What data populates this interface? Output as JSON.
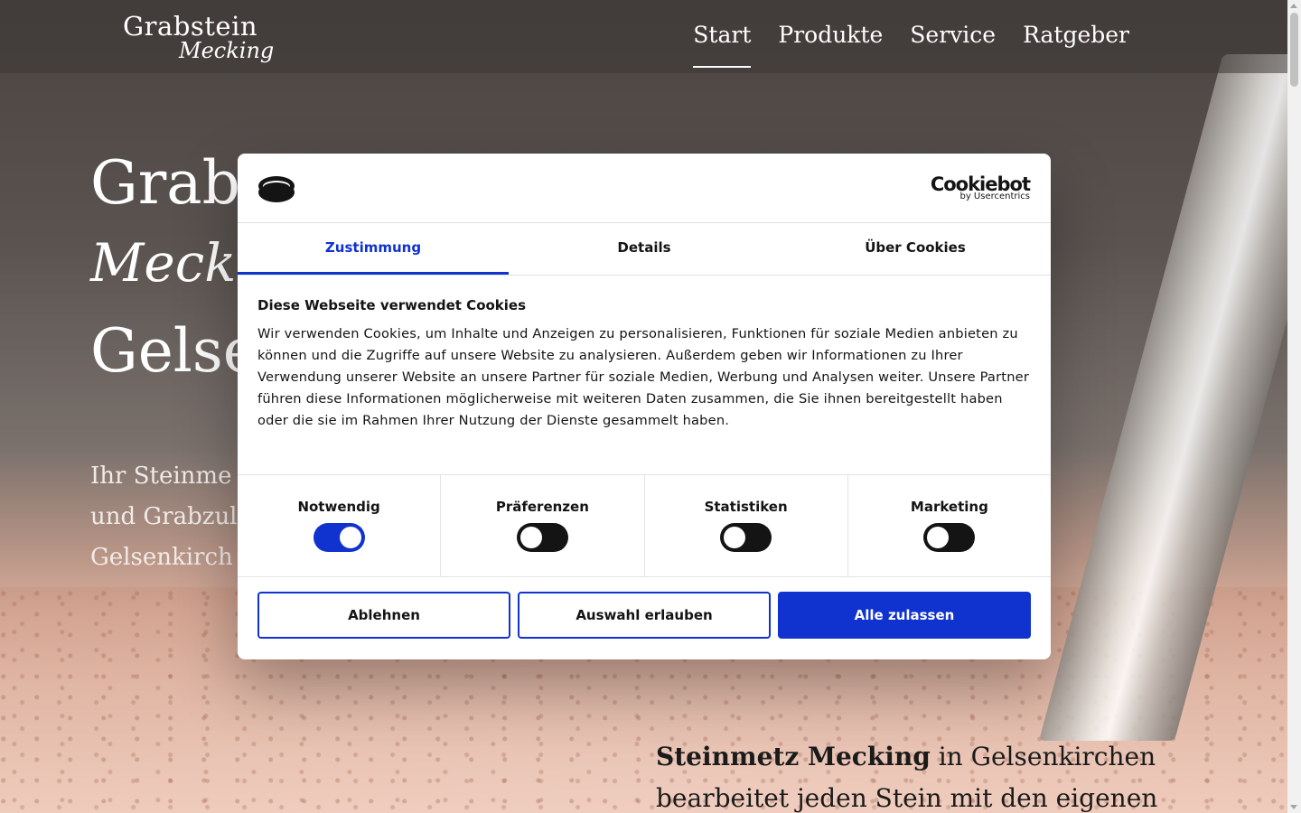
{
  "header": {
    "logo_line1": "Grabstein",
    "logo_line2": "Mecking",
    "nav": [
      "Start",
      "Produkte",
      "Service",
      "Ratgeber"
    ],
    "active_nav": "Start"
  },
  "hero": {
    "title_line1": "Grabs",
    "title_line2": "Mecki",
    "title_line3": "Gelse",
    "sub_lines": [
      "Ihr Steinme",
      "und Grabzul",
      "Gelsenkirch"
    ]
  },
  "intro": {
    "bold": "Steinmetz Mecking",
    "rest": " in Gelsenkirchen bearbeitet jeden Stein mit den eigenen"
  },
  "cookie": {
    "brand_name": "Cookiebot",
    "brand_sub": "by Usercentrics",
    "tabs": [
      "Zustimmung",
      "Details",
      "Über Cookies"
    ],
    "active_tab": "Zustimmung",
    "heading": "Diese Webseite verwendet Cookies",
    "text": "Wir verwenden Cookies, um Inhalte und Anzeigen zu personalisieren, Funktionen für soziale Medien anbieten zu können und die Zugriffe auf unsere Website zu analysieren. Außerdem geben wir Informationen zu Ihrer Verwendung unserer Website an unsere Partner für soziale Medien, Werbung und Analysen weiter. Unsere Partner führen diese Informationen möglicherweise mit weiteren Daten zusammen, die Sie ihnen bereitgestellt haben oder die sie im Rahmen Ihrer Nutzung der Dienste gesammelt haben.",
    "consents": [
      {
        "label": "Notwendig",
        "on": true
      },
      {
        "label": "Präferenzen",
        "on": false
      },
      {
        "label": "Statistiken",
        "on": false
      },
      {
        "label": "Marketing",
        "on": false
      }
    ],
    "buttons": {
      "decline": "Ablehnen",
      "allow_selection": "Auswahl erlauben",
      "allow_all": "Alle zulassen"
    },
    "colors": {
      "accent": "#1032cf",
      "dark": "#141414"
    }
  }
}
